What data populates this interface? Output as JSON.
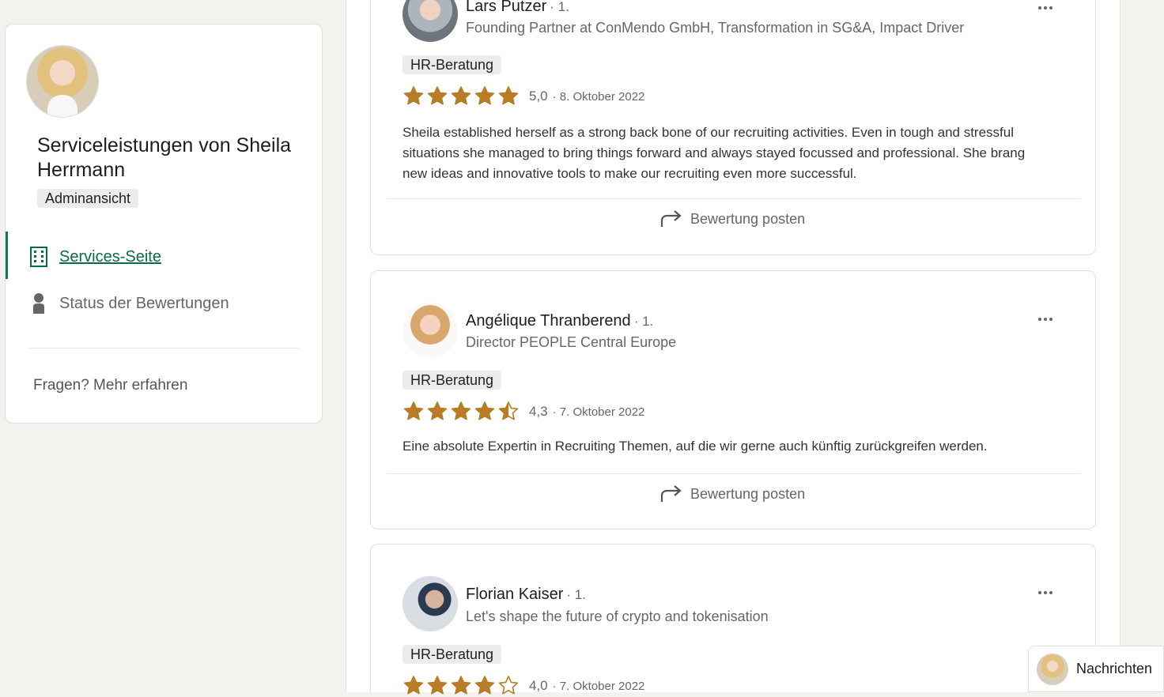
{
  "sidebar": {
    "title": "Serviceleistungen von Sheila Herrmann",
    "badge": "Adminansicht",
    "nav": [
      {
        "label": "Services-Seite",
        "icon": "building-icon",
        "active": true
      },
      {
        "label": "Status der Bewertungen",
        "icon": "person-icon",
        "active": false
      }
    ],
    "help_link": "Fragen? Mehr erfahren"
  },
  "reviews": [
    {
      "name": "Lars Putzer",
      "degree": "· 1.",
      "headline": "Founding Partner at ConMendo GmbH, Transformation in SG&A, Impact Driver",
      "tag": "HR-Beratung",
      "rating": 5.0,
      "rating_label": "5,0",
      "date": "· 8. Oktober 2022",
      "text": "Sheila established herself as a strong back bone of our recruiting activities. Even in tough and stressful situations she managed to bring things forward and always stayed focussed and professional. She brang new ideas and innovative tools to make our recruiting even more successful.",
      "post_label": "Bewertung posten"
    },
    {
      "name": "Angélique Thranberend",
      "degree": "· 1.",
      "headline": "Director PEOPLE Central Europe",
      "tag": "HR-Beratung",
      "rating": 4.3,
      "rating_label": "4,3",
      "date": "· 7. Oktober 2022",
      "text": "Eine absolute Expertin in Recruiting Themen, auf die wir gerne auch künftig zurückgreifen werden.",
      "post_label": "Bewertung posten"
    },
    {
      "name": "Florian Kaiser",
      "degree": "· 1.",
      "headline": "Let's shape the future of crypto and tokenisation",
      "tag": "HR-Beratung",
      "rating": 4.0,
      "rating_label": "4,0",
      "date": "· 7. Oktober 2022"
    }
  ],
  "messaging": {
    "label": "Nachrichten"
  },
  "colors": {
    "star": "#b77c25",
    "link_active": "#0d6b43"
  }
}
